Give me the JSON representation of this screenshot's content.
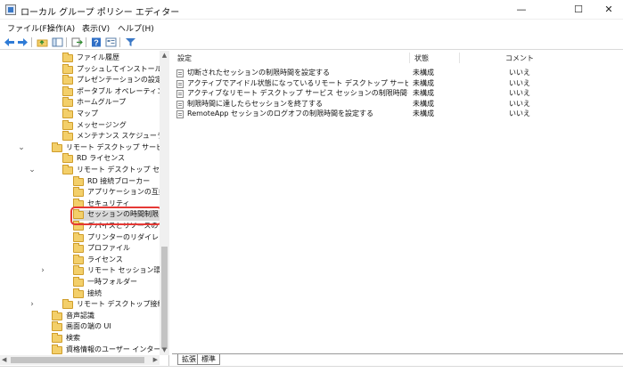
{
  "window": {
    "title": "ローカル グループ ポリシー エディター",
    "minimize": "—",
    "maximize": "☐",
    "close": "✕"
  },
  "menu": [
    "ファイル(F)",
    "操作(A)",
    "表示(V)",
    "ヘルプ(H)"
  ],
  "toolbar_icons": [
    "back-arrow-icon",
    "forward-arrow-icon",
    "up-folder-icon",
    "show-hide-tree-icon",
    "export-list-icon",
    "help-icon",
    "properties-icon",
    "filter-icon"
  ],
  "tree": [
    {
      "label": "ファイル履歴",
      "expander": ""
    },
    {
      "label": "プッシュしてインストール",
      "expander": ""
    },
    {
      "label": "プレゼンテーションの設定",
      "expander": ""
    },
    {
      "label": "ポータブル オペレーティング システ",
      "expander": ""
    },
    {
      "label": "ホームグループ",
      "expander": ""
    },
    {
      "label": "マップ",
      "expander": ""
    },
    {
      "label": "メッセージング",
      "expander": ""
    },
    {
      "label": "メンテナンス スケジューラ",
      "expander": ""
    },
    {
      "label": "リモート デスクトップ サービス",
      "expander": "⌄"
    },
    {
      "label": "RD ライセンス",
      "expander": ""
    },
    {
      "label": "リモート デスクトップ セッション",
      "expander": "⌄"
    },
    {
      "label": "RD 接続ブローカー",
      "expander": ""
    },
    {
      "label": "アプリケーションの互換性",
      "expander": ""
    },
    {
      "label": "セキュリティ",
      "expander": ""
    },
    {
      "label": "セッションの時間制限",
      "expander": ""
    },
    {
      "label": "デバイスとリソースのリダイ",
      "expander": ""
    },
    {
      "label": "プリンターのリダイレクト",
      "expander": ""
    },
    {
      "label": "プロファイル",
      "expander": ""
    },
    {
      "label": "ライセンス",
      "expander": ""
    },
    {
      "label": "リモート セッション環境",
      "expander": "›"
    },
    {
      "label": "一時フォルダー",
      "expander": ""
    },
    {
      "label": "接続",
      "expander": ""
    },
    {
      "label": "リモート デスクトップ接続のク",
      "expander": "›"
    },
    {
      "label": "音声認識",
      "expander": ""
    },
    {
      "label": "画面の端の UI",
      "expander": ""
    },
    {
      "label": "検索",
      "expander": ""
    },
    {
      "label": "資格情報のユーザー インターフェ",
      "expander": ""
    }
  ],
  "columns": {
    "setting": "設定",
    "state": "状態",
    "comment": "コメント"
  },
  "policies": [
    {
      "name": "切断されたセッションの制限時間を設定する",
      "state": "未構成",
      "comment": "いいえ"
    },
    {
      "name": "アクティブでアイドル状態になっているリモート デスクトップ サービス セッ...",
      "state": "未構成",
      "comment": "いいえ"
    },
    {
      "name": "アクティブなリモート デスクトップ サービス セッションの制限時間を設定...",
      "state": "未構成",
      "comment": "いいえ"
    },
    {
      "name": "制限時間に達したらセッションを終了する",
      "state": "未構成",
      "comment": "いいえ"
    },
    {
      "name": "RemoteApp セッションのログオフの制限時間を設定する",
      "state": "未構成",
      "comment": "いいえ"
    }
  ],
  "tabs": [
    "拡張",
    "標準"
  ],
  "accent_color": "#e53935"
}
